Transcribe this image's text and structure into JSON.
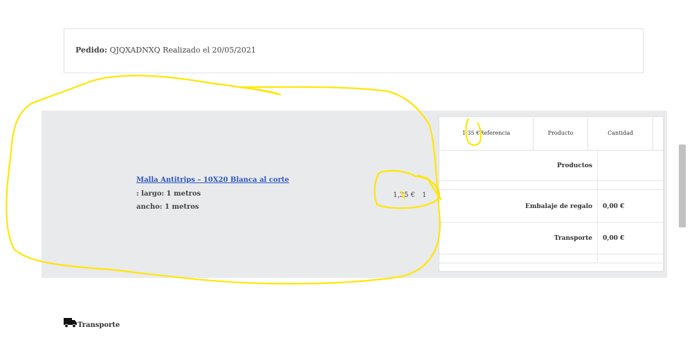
{
  "order": {
    "label": "Pedido:",
    "code": "QJQXADNXQ",
    "date_text": "Realizado el 20/05/2021"
  },
  "item": {
    "name": "Malla Antitrips – 10X20 Blanca al corte",
    "attr1": ": largo: 1 metros",
    "attr2": "ancho: 1 metros",
    "price": "1,35 €",
    "quantity": "1"
  },
  "table": {
    "header_price": "1,35 €",
    "headers": [
      "Referencia",
      "Producto",
      "Cantidad"
    ],
    "rows": {
      "products_label": "Productos",
      "gift_label": "Embalaje de regalo",
      "gift_value": "0,00 €",
      "shipping_label": "Transporte",
      "shipping_value": "0,00 €"
    }
  },
  "section": {
    "transport_title": "Transporte"
  },
  "icons": {
    "truck": "truck-icon"
  },
  "colors": {
    "link": "#2a55c2",
    "highlight": "#ffe600",
    "panel": "#e9eaec"
  }
}
